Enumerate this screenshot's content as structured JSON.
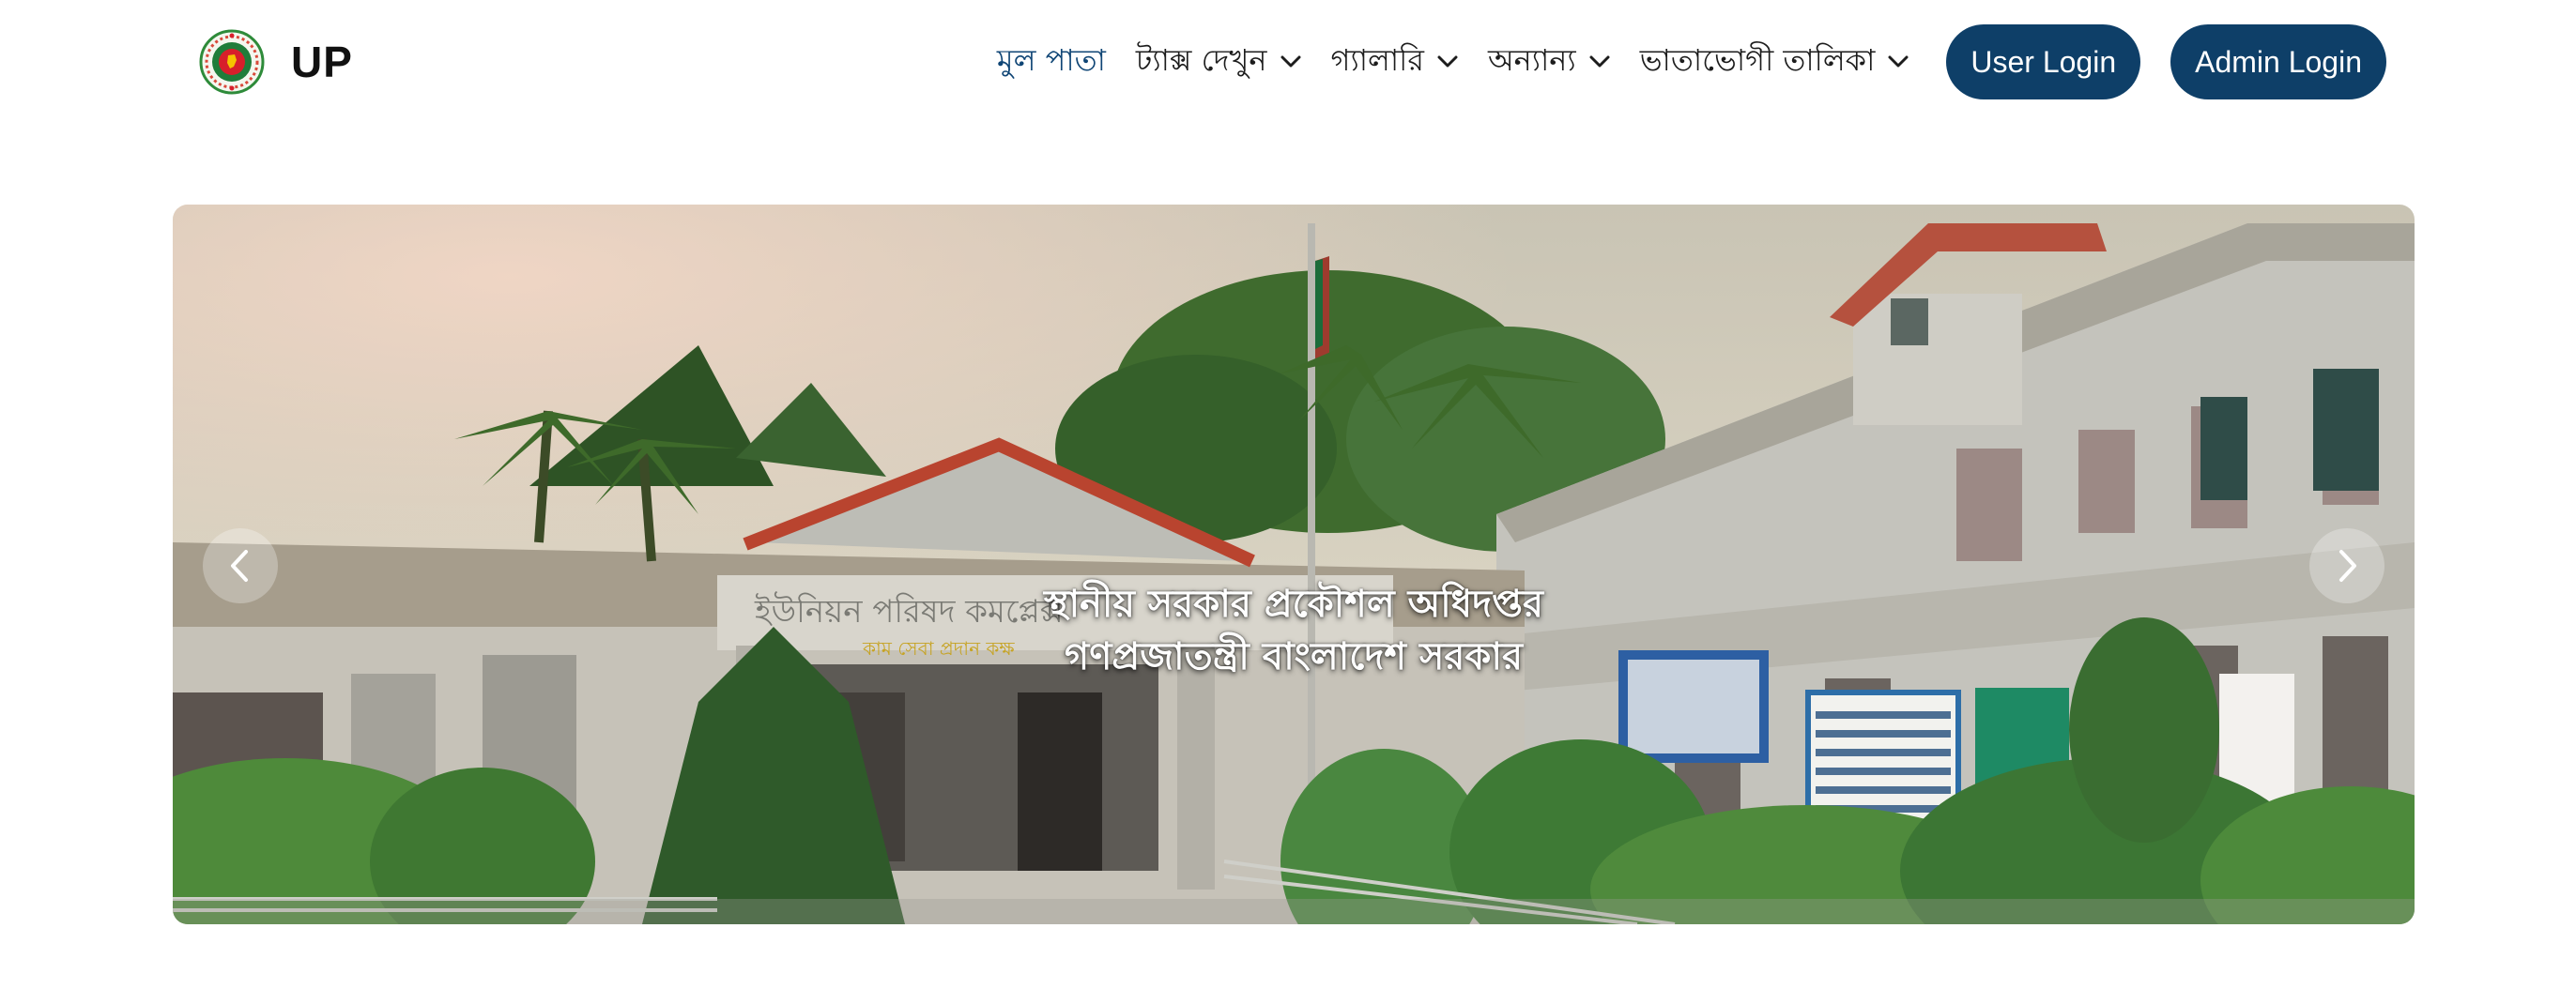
{
  "brand": {
    "logo": "bangladesh-govt-seal-icon",
    "text": "UP"
  },
  "nav": {
    "items": [
      {
        "label": "মুল পাতা",
        "active": true,
        "dropdown": false
      },
      {
        "label": "ট্যাক্স দেখুন",
        "active": false,
        "dropdown": true
      },
      {
        "label": "গ্যালারি",
        "active": false,
        "dropdown": true
      },
      {
        "label": "অন্যান্য",
        "active": false,
        "dropdown": true
      },
      {
        "label": "ভাতাভোগী তালিকা",
        "active": false,
        "dropdown": true
      }
    ],
    "user_login": "User Login",
    "admin_login": "Admin Login"
  },
  "carousel": {
    "image": "union-parishad-building-photo",
    "caption_line1": "স্থানীয় সরকার প্রকৌশল অধিদপ্তর",
    "caption_line2": "গণপ্রজাতন্ত্রী বাংলাদেশ সরকার",
    "prev_icon": "chevron-left-icon",
    "next_icon": "chevron-right-icon"
  },
  "colors": {
    "primary": "#0e3f68",
    "active_link": "#0f4575",
    "text": "#1c1c1c",
    "background": "#ffffff"
  }
}
